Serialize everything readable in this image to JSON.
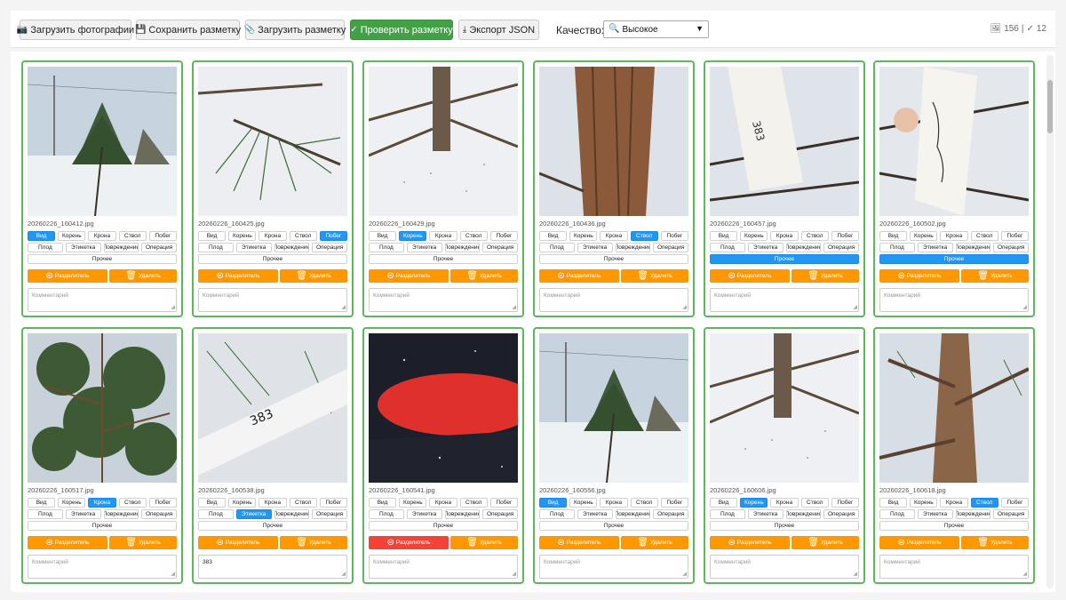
{
  "toolbar": {
    "upload_photos": "Загрузить фотографии",
    "save_markup": "Сохранить разметку",
    "load_markup": "Загрузить разметку",
    "check_markup": "Проверить разметку",
    "export_json": "Экспорт JSON",
    "quality_label": "Качество:",
    "quality_value": "Высокое",
    "stats_total": "156",
    "stats_checked": "12"
  },
  "labels": {
    "tags_row1": [
      "Вид",
      "Корень",
      "Крона",
      "Ствол",
      "Побег"
    ],
    "tags_row2": [
      "Плод",
      "Этикетка",
      "Повреждение",
      "Операция"
    ],
    "other": "Прочее",
    "split": "Разделитель",
    "delete": "Удалить",
    "comment_placeholder": "Комментарий"
  },
  "cards": [
    {
      "file": "20260226_160412.jpg",
      "active": [
        "Вид"
      ],
      "comment": "",
      "scene": "tree-field"
    },
    {
      "file": "20260226_160425.jpg",
      "active": [
        "Побег"
      ],
      "comment": "",
      "scene": "needles-closeup"
    },
    {
      "file": "20260226_160429.jpg",
      "active": [
        "Корень"
      ],
      "comment": "",
      "scene": "trunk-base"
    },
    {
      "file": "20260226_160436.jpg",
      "active": [
        "Ствол"
      ],
      "comment": "",
      "scene": "bark"
    },
    {
      "file": "20260226_160457.jpg",
      "active": [
        "Прочее"
      ],
      "comment": "",
      "scene": "tag-label"
    },
    {
      "file": "20260226_160502.jpg",
      "active": [
        "Прочее"
      ],
      "comment": "",
      "scene": "tag-handwritten"
    },
    {
      "file": "20260226_160517.jpg",
      "active": [
        "Крона"
      ],
      "comment": "",
      "scene": "crown"
    },
    {
      "file": "20260226_160538.jpg",
      "active": [
        "Этикетка"
      ],
      "comment": "383",
      "scene": "tag-383"
    },
    {
      "file": "20260226_160541.jpg",
      "active": [],
      "comment": "",
      "scene": "glove",
      "split_red": true
    },
    {
      "file": "20260226_160556.jpg",
      "active": [
        "Вид"
      ],
      "comment": "",
      "scene": "tree-field"
    },
    {
      "file": "20260226_160606.jpg",
      "active": [
        "Корень"
      ],
      "comment": "",
      "scene": "trunk-base"
    },
    {
      "file": "20260226_160618.jpg",
      "active": [
        "Ствол"
      ],
      "comment": "",
      "scene": "bark-branches"
    }
  ]
}
